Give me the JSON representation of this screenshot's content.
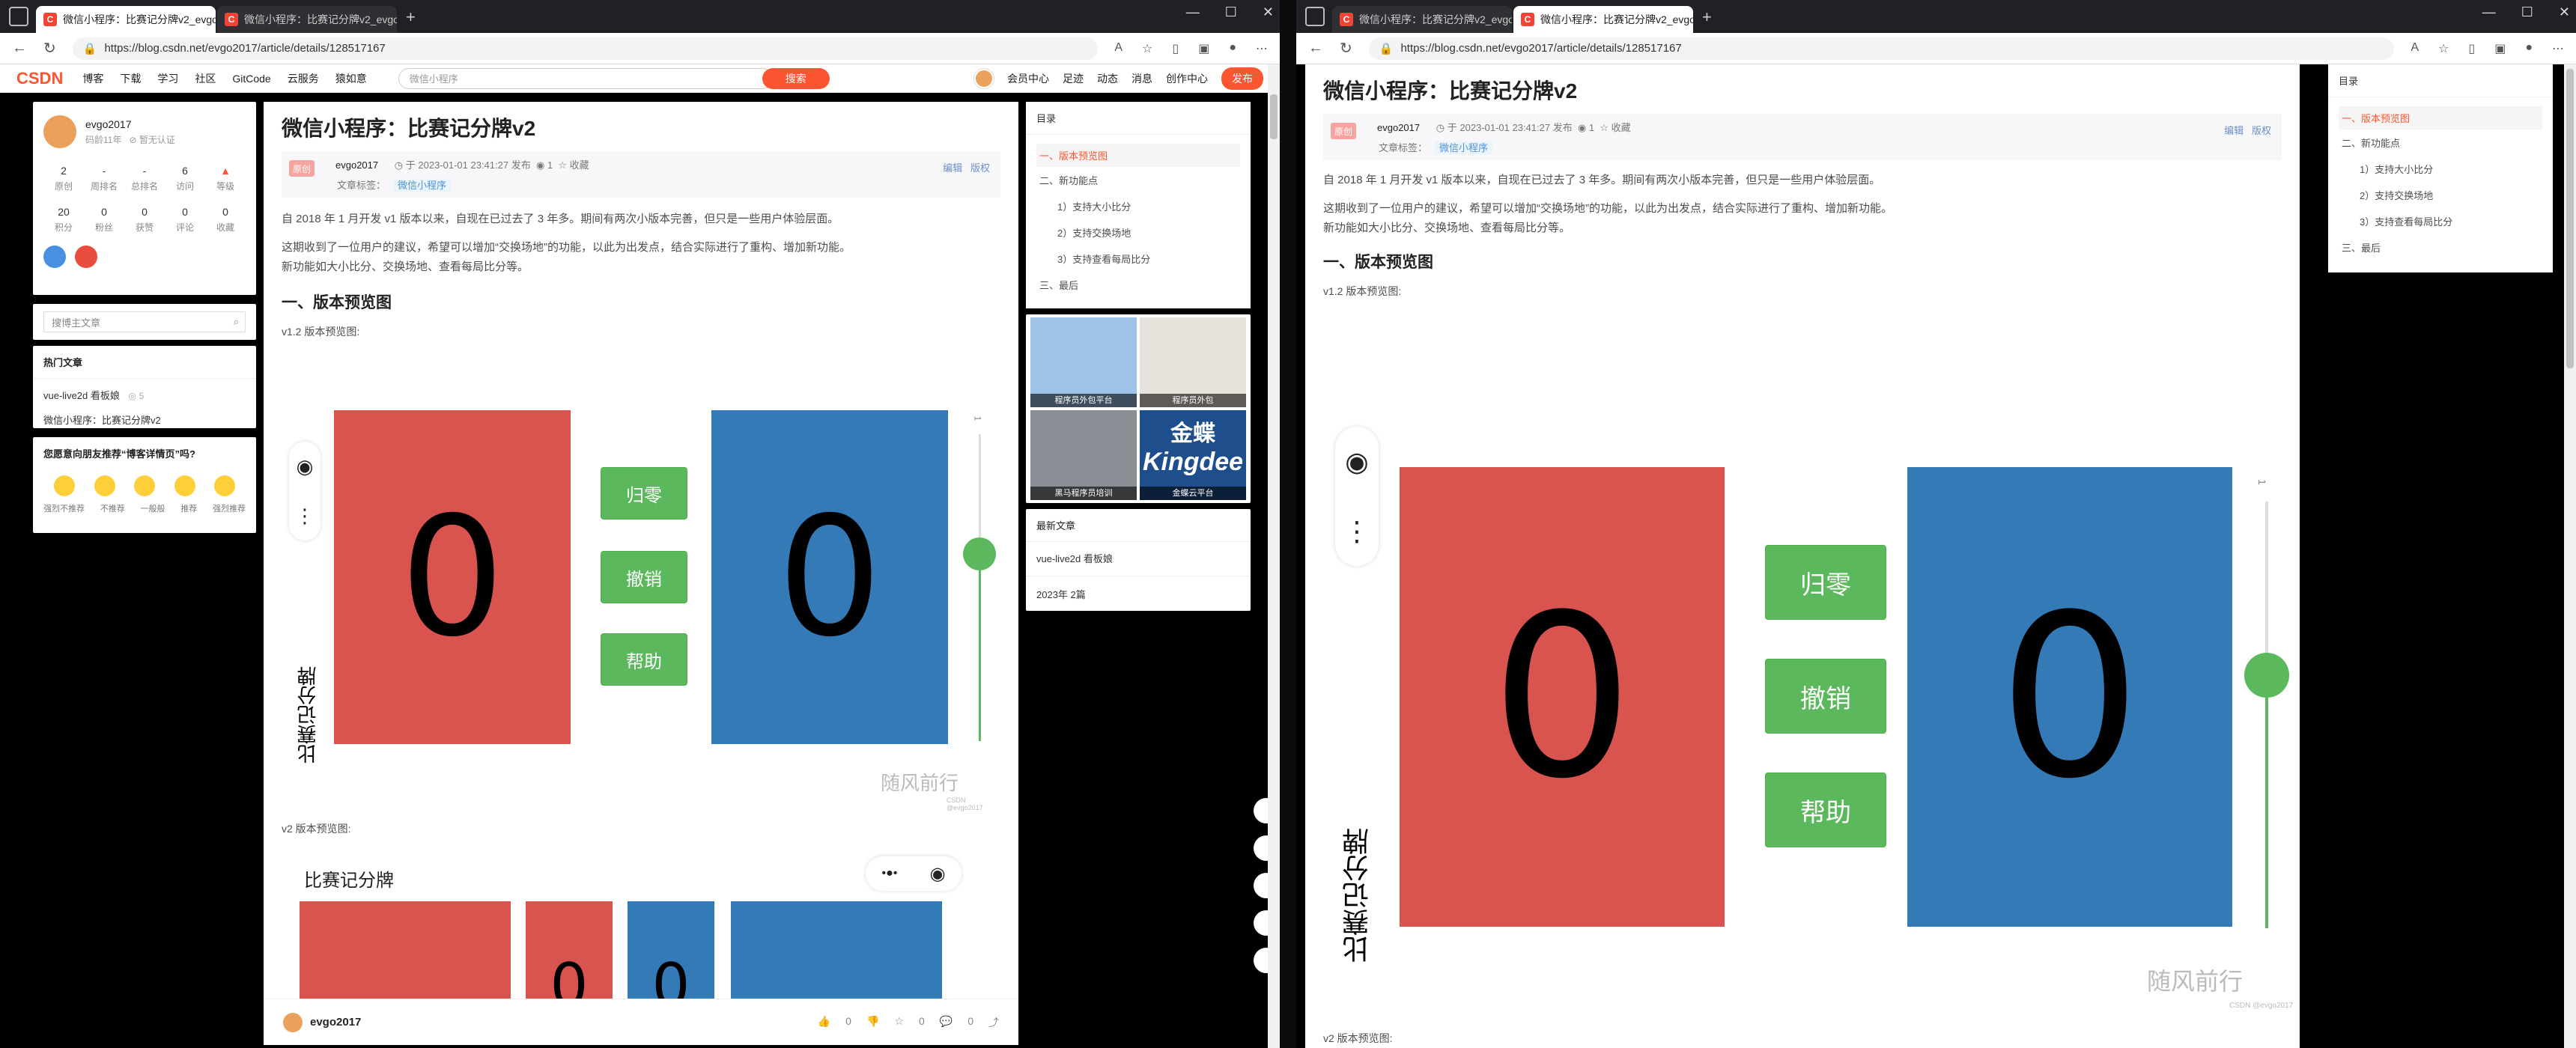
{
  "tabs": [
    {
      "title": "微信小程序：比赛记分牌v2_evgo"
    },
    {
      "title": "微信小程序：比赛记分牌v2_evgo"
    }
  ],
  "address": {
    "url": "https://blog.csdn.net/evgo2017/article/details/128517167"
  },
  "topnav": {
    "logo": "CSDN",
    "items": [
      "博客",
      "下载",
      "学习",
      "社区",
      "GitCode",
      "云服务",
      "猿如意"
    ],
    "search_placeholder": "微信小程序",
    "search_button": "搜索",
    "right_items": [
      "会员中心",
      "足迹",
      "动态",
      "消息",
      "创作中心"
    ],
    "publish": "发布"
  },
  "profile": {
    "name": "evgo2017",
    "years": "码龄11年",
    "cert": "暂无认证",
    "stats_row1": [
      {
        "value": "2",
        "label": "原创"
      },
      {
        "value": "-",
        "label": "周排名"
      },
      {
        "value": "-",
        "label": "总排名"
      },
      {
        "value": "6",
        "label": "访问"
      },
      {
        "value": "",
        "label": "等级"
      }
    ],
    "stats_row2": [
      {
        "value": "20",
        "label": "积分"
      },
      {
        "value": "0",
        "label": "粉丝"
      },
      {
        "value": "0",
        "label": "获赞"
      },
      {
        "value": "0",
        "label": "评论"
      },
      {
        "value": "0",
        "label": "收藏"
      }
    ]
  },
  "search_side": {
    "placeholder": "搜博主文章"
  },
  "hot": {
    "title": "热门文章",
    "items": [
      {
        "title": "vue-live2d 看板娘",
        "count": "5"
      },
      {
        "title": "微信小程序：比赛记分牌v2",
        "count": ""
      }
    ]
  },
  "recommend": {
    "question": "您愿意向朋友推荐“博客详情页”吗?",
    "options": [
      "强烈不推荐",
      "不推荐",
      "一般般",
      "推荐",
      "强烈推荐"
    ]
  },
  "article": {
    "title": "微信小程序：比赛记分牌v2",
    "badge": "原创",
    "author": "evgo2017",
    "date": "于 2023-01-01 23:41:27 发布",
    "views": "1",
    "fav": "收藏",
    "edit": "编辑",
    "copyright": "版权",
    "tag_label": "文章标签：",
    "tag": "微信小程序",
    "p1": "自 2018 年 1 月开发 v1 版本以来，自现在已过去了 3 年多。期间有两次小版本完善，但只是一些用户体验层面。",
    "p2": "这期收到了一位用户的建议，希望可以增加“交换场地”的功能，以此为出发点，结合实际进行了重构、增加新功能。",
    "p3": "新功能如大小比分、交换场地、查看每局比分等。",
    "h2": "一、版本预览图",
    "v12": "v1.2 版本预览图:",
    "v2": "v2 版本预览图:"
  },
  "scoreboard": {
    "left_score": "0",
    "right_score": "0",
    "btn_reset": "归零",
    "btn_undo": "撤销",
    "btn_help": "帮助",
    "vertical_title": "比赛记分牌",
    "slider_value": "1",
    "watermark": "随风前行",
    "credit": "CSDN @evgo2017",
    "v2_title": "比赛记分牌",
    "v2_small_left": "0",
    "v2_small_right": "0"
  },
  "toc": {
    "title": "目录",
    "items": [
      "一、版本预览图",
      "二、新功能点",
      "1）支持大小比分",
      "2）支持交换场地",
      "3）支持查看每局比分",
      "三、最后"
    ]
  },
  "ads": [
    "程序员外包平台",
    "程序员外包",
    "黑马程序员培训",
    "金蝶云平台"
  ],
  "ad_kingdee": {
    "cn": "金蝶",
    "en": "Kingdee"
  },
  "recent": {
    "title": "最新文章",
    "items": [
      "vue-live2d 看板娘"
    ],
    "archive": "2023年 2篇"
  },
  "bottom": {
    "author": "evgo2017",
    "likes": "0",
    "stars": "0",
    "comments": "0"
  }
}
